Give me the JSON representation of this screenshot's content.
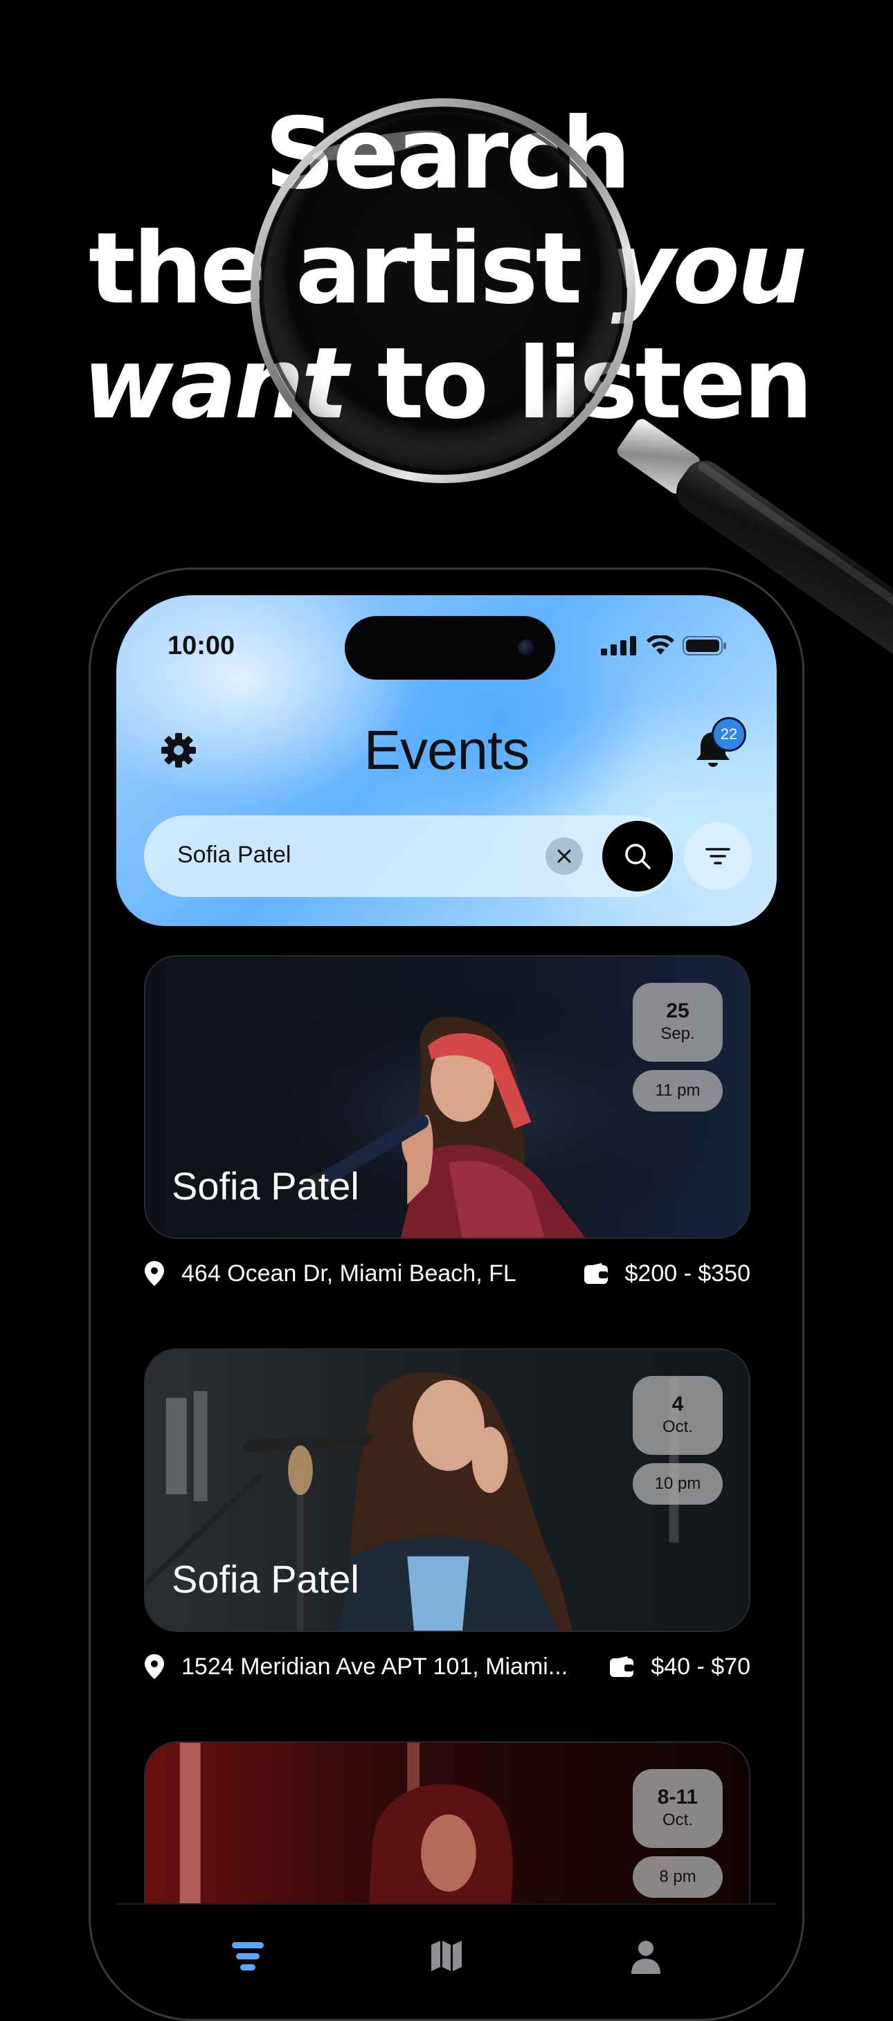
{
  "hero": {
    "line1": "Search",
    "line2_plain": "the artist ",
    "line2_em": "you",
    "line3_em": "want",
    "line3_plain": " to listen"
  },
  "status_bar": {
    "time": "10:00"
  },
  "header": {
    "title": "Events",
    "notification_count": "22",
    "settings_icon": "gear-icon",
    "bell_icon": "bell-icon"
  },
  "search": {
    "value": "Sofia Patel",
    "clear_icon": "close-icon",
    "search_icon": "search-icon",
    "filter_icon": "filter-icon"
  },
  "events": [
    {
      "artist": "Sofia Patel",
      "day": "25",
      "month": "Sep.",
      "time": "11 pm",
      "address": "464 Ocean Dr, Miami Beach, FL",
      "price": "$200 - $350"
    },
    {
      "artist": "Sofia Patel",
      "day": "4",
      "month": "Oct.",
      "time": "10 pm",
      "address": "1524 Meridian Ave APT 101, Miami...",
      "price": "$40 - $70"
    },
    {
      "artist": "",
      "day": "8-11",
      "month": "Oct.",
      "time": "8 pm",
      "address": "",
      "price": ""
    }
  ],
  "tabs": [
    {
      "icon": "events-list-icon",
      "active": true
    },
    {
      "icon": "map-icon",
      "active": false
    },
    {
      "icon": "profile-icon",
      "active": false
    }
  ],
  "colors": {
    "accent": "#2f86e6",
    "tab_active": "#5aa9ff",
    "badge_bg": "#aaaaaa"
  }
}
